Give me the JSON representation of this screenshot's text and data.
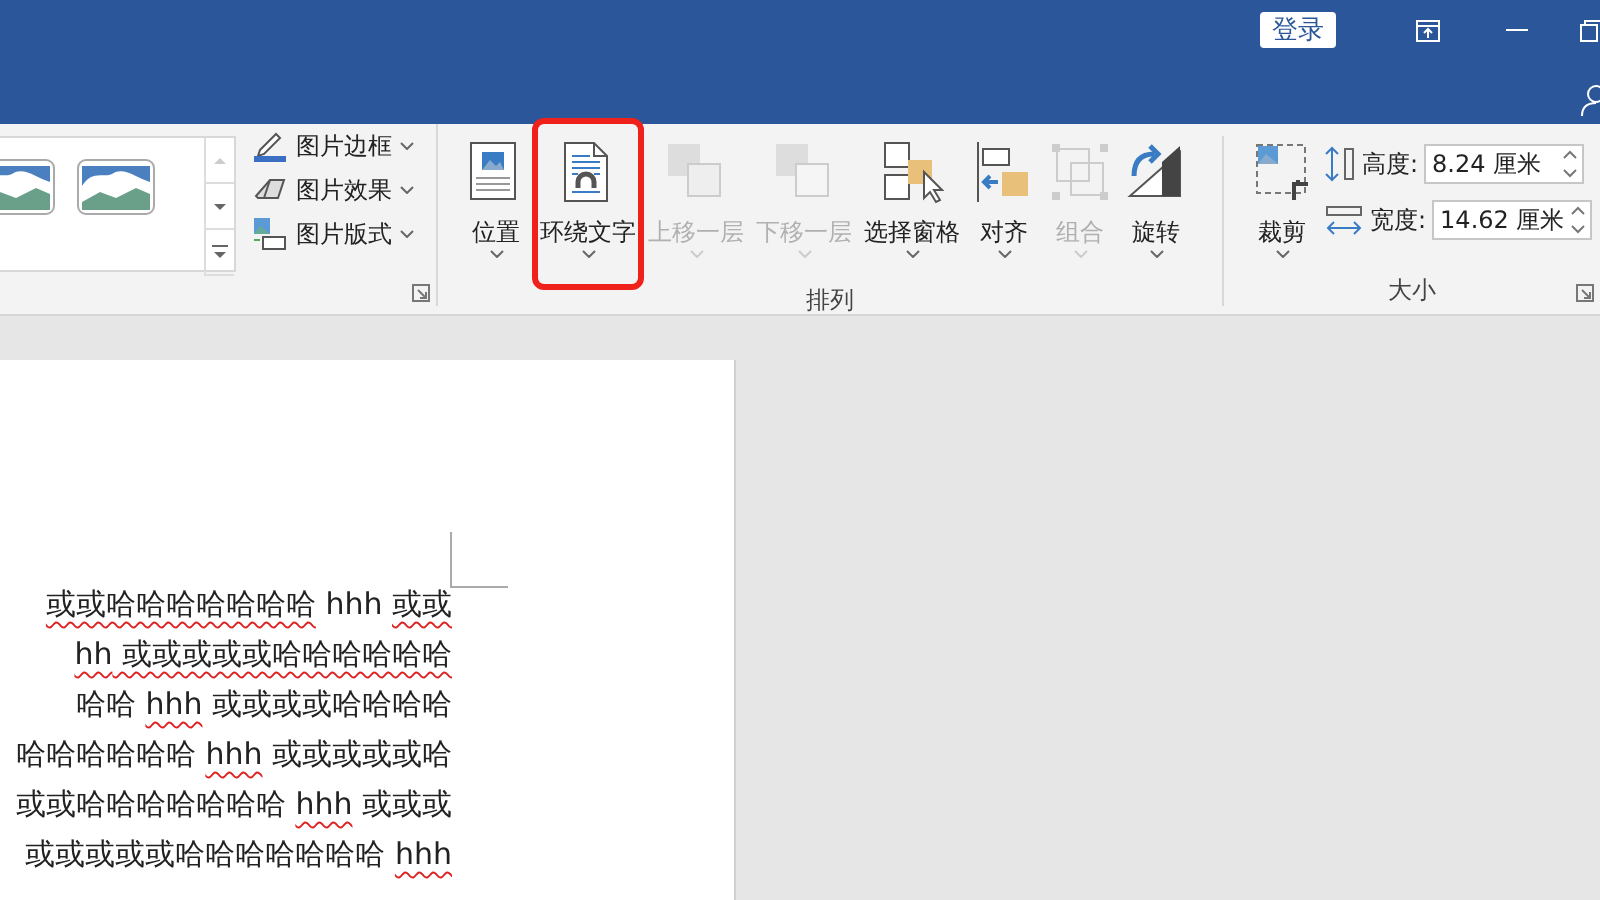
{
  "title_bar": {
    "sign_in_button": "登录"
  },
  "ribbon": {
    "picture_styles": {
      "options": [
        {
          "kind": "border",
          "label": "图片边框"
        },
        {
          "kind": "effects",
          "label": "图片效果"
        },
        {
          "kind": "layout",
          "label": "图片版式"
        }
      ]
    },
    "arrange": {
      "label": "排列",
      "buttons": [
        {
          "kind": "position",
          "label": "位置",
          "disabled": false,
          "highlighted": false
        },
        {
          "kind": "wrap",
          "label": "环绕文字",
          "disabled": false,
          "highlighted": true
        },
        {
          "kind": "forward",
          "label": "上移一层",
          "disabled": true,
          "highlighted": false
        },
        {
          "kind": "backward",
          "label": "下移一层",
          "disabled": true,
          "highlighted": false
        },
        {
          "kind": "pane",
          "label": "选择窗格",
          "disabled": false,
          "highlighted": false
        },
        {
          "kind": "align",
          "label": "对齐",
          "disabled": false,
          "highlighted": false
        },
        {
          "kind": "group",
          "label": "组合",
          "disabled": true,
          "highlighted": false
        },
        {
          "kind": "rotate",
          "label": "旋转",
          "disabled": false,
          "highlighted": false
        }
      ]
    },
    "size": {
      "label": "大小",
      "crop_button": "裁剪",
      "fields": [
        {
          "kind": "height",
          "label": "高度:",
          "value": "8.24 厘米"
        },
        {
          "kind": "width",
          "label": "宽度:",
          "value": "14.62 厘米"
        }
      ]
    }
  },
  "document": {
    "lines": [
      [
        {
          "text": "或或哈哈哈哈哈哈哈",
          "misspelled": true
        },
        {
          "text": " hhh ",
          "misspelled": false
        },
        {
          "text": "或或",
          "misspelled": true
        }
      ],
      [
        {
          "text": "hh",
          "misspelled": true
        },
        {
          "text": " 或或或或或哈哈哈哈哈哈",
          "misspelled": true
        }
      ],
      [
        {
          "text": "哈哈 ",
          "misspelled": false
        },
        {
          "text": "hhh",
          "misspelled": true
        },
        {
          "text": " 或或或或哈哈哈哈",
          "misspelled": false
        }
      ],
      [
        {
          "text": "哈哈哈哈哈哈 ",
          "misspelled": false
        },
        {
          "text": "hhh",
          "misspelled": true
        },
        {
          "text": " 或或或或或哈",
          "misspelled": false
        }
      ],
      [
        {
          "text": "或或哈哈哈哈哈哈哈 ",
          "misspelled": false
        },
        {
          "text": "hhh",
          "misspelled": true
        },
        {
          "text": " 或或或",
          "misspelled": false
        }
      ],
      [
        {
          "text": "或或或或或哈哈哈哈哈哈哈 ",
          "misspelled": false
        },
        {
          "text": "hhh",
          "misspelled": true
        }
      ]
    ]
  }
}
